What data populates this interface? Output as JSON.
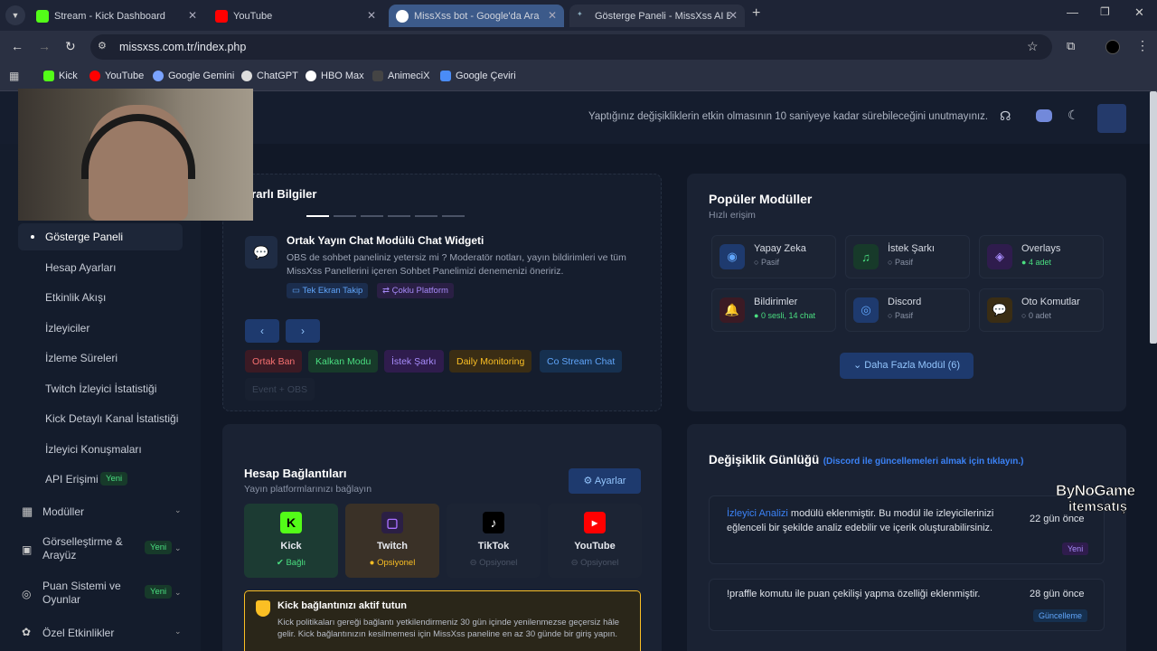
{
  "tabs": [
    {
      "label": "Stream - Kick Dashboard"
    },
    {
      "label": "YouTube"
    },
    {
      "label": "MissXss bot - Google'da Ara"
    },
    {
      "label": "Gösterge Paneli - MissXss AI Bo"
    }
  ],
  "address": {
    "url": "missxss.com.tr/index.php"
  },
  "bookmarks": [
    "Kick",
    "YouTube",
    "Google Gemini",
    "ChatGPT",
    "HBO Max",
    "AnimeciX",
    "Google Çeviri"
  ],
  "header": {
    "notice": "Yaptığınız değişikliklerin etkin olmasının 10 saniyeye kadar sürebileceğini unutmayınız."
  },
  "sidebar": {
    "items": [
      "Gösterge Paneli",
      "Hesap Ayarları",
      "Etkinlik Akışı",
      "İzleyiciler",
      "İzleme Süreleri",
      "Twitch İzleyici İstatistiği",
      "Kick Detaylı Kanal İstatistiği",
      "İzleyici Konuşmaları",
      "API Erişimi"
    ],
    "api_badge": "Yeni",
    "groups": [
      {
        "label": "Modüller"
      },
      {
        "label": "Görselleştirme & Arayüz",
        "badge": "Yeni"
      },
      {
        "label": "Puan Sistemi ve Oyunlar",
        "badge": "Yeni"
      },
      {
        "label": "Özel Etkinlikler"
      }
    ]
  },
  "info": {
    "title": "Yararlı Bilgiler",
    "item_title": "Ortak Yayın Chat Modülü Chat Widgeti",
    "item_text": "OBS de sohbet paneliniz yetersiz mi ? Moderatör notları, yayın bildirimleri ve tüm MissXss Panellerini içeren Sohbet Panelimizi denemenizi öneririz.",
    "tag1": "Tek Ekran Takip",
    "tag2": "Çoklu Platform",
    "chips": [
      "Ortak Ban",
      "Kalkan Modu",
      "İstek Şarkı",
      "Daily Monitoring",
      "Co Stream Chat",
      "Event + OBS"
    ]
  },
  "popular": {
    "title": "Popüler Modüller",
    "subtitle": "Hızlı erişim",
    "modules": [
      {
        "name": "Yapay Zeka",
        "status": "Pasif"
      },
      {
        "name": "İstek Şarkı",
        "status": "Pasif"
      },
      {
        "name": "Overlays",
        "status": "4 adet"
      },
      {
        "name": "Bildirimler",
        "status": "0 sesli, 14 chat"
      },
      {
        "name": "Discord",
        "status": "Pasif"
      },
      {
        "name": "Oto Komutlar",
        "status": "0 adet"
      }
    ],
    "more": "Daha Fazla Modül (6)"
  },
  "accounts": {
    "title": "Hesap Bağlantıları",
    "subtitle": "Yayın platformlarınızı bağlayın",
    "settings": "Ayarlar",
    "platforms": [
      {
        "name": "Kick",
        "status": "Bağlı"
      },
      {
        "name": "Twitch",
        "status": "Opsiyonel"
      },
      {
        "name": "TikTok",
        "status": "Opsiyonel"
      },
      {
        "name": "YouTube",
        "status": "Opsiyonel"
      }
    ],
    "warn_title": "Kick bağlantınızı aktif tutun",
    "warn_text": "Kick politikaları gereği bağlantı yetkilendirmeniz 30 gün içinde yenilenmezse geçersiz hâle gelir. Kick bağlantınızın kesilmemesi için MissXss paneline en az 30 günde bir giriş yapın."
  },
  "changelog": {
    "title": "Değişiklik Günlüğü",
    "link": "(Discord ile güncellemeleri almak için tıklayın.)",
    "entries": [
      {
        "highlight": "İzleyici Analizi",
        "text": " modülü eklenmiştir. Bu modül ile izleyicilerinizi eğlenceli bir şekilde analiz edebilir ve içerik oluşturabilirsiniz.",
        "time": "22 gün önce",
        "badge": "Yeni"
      },
      {
        "highlight": "",
        "text": "!praffle komutu ile puan çekilişi yapma özelliği eklenmiştir.",
        "time": "28 gün önce",
        "badge": "Güncelleme"
      }
    ]
  },
  "watermark": {
    "line1": "ByNoGame",
    "line2": "itemsatış"
  }
}
